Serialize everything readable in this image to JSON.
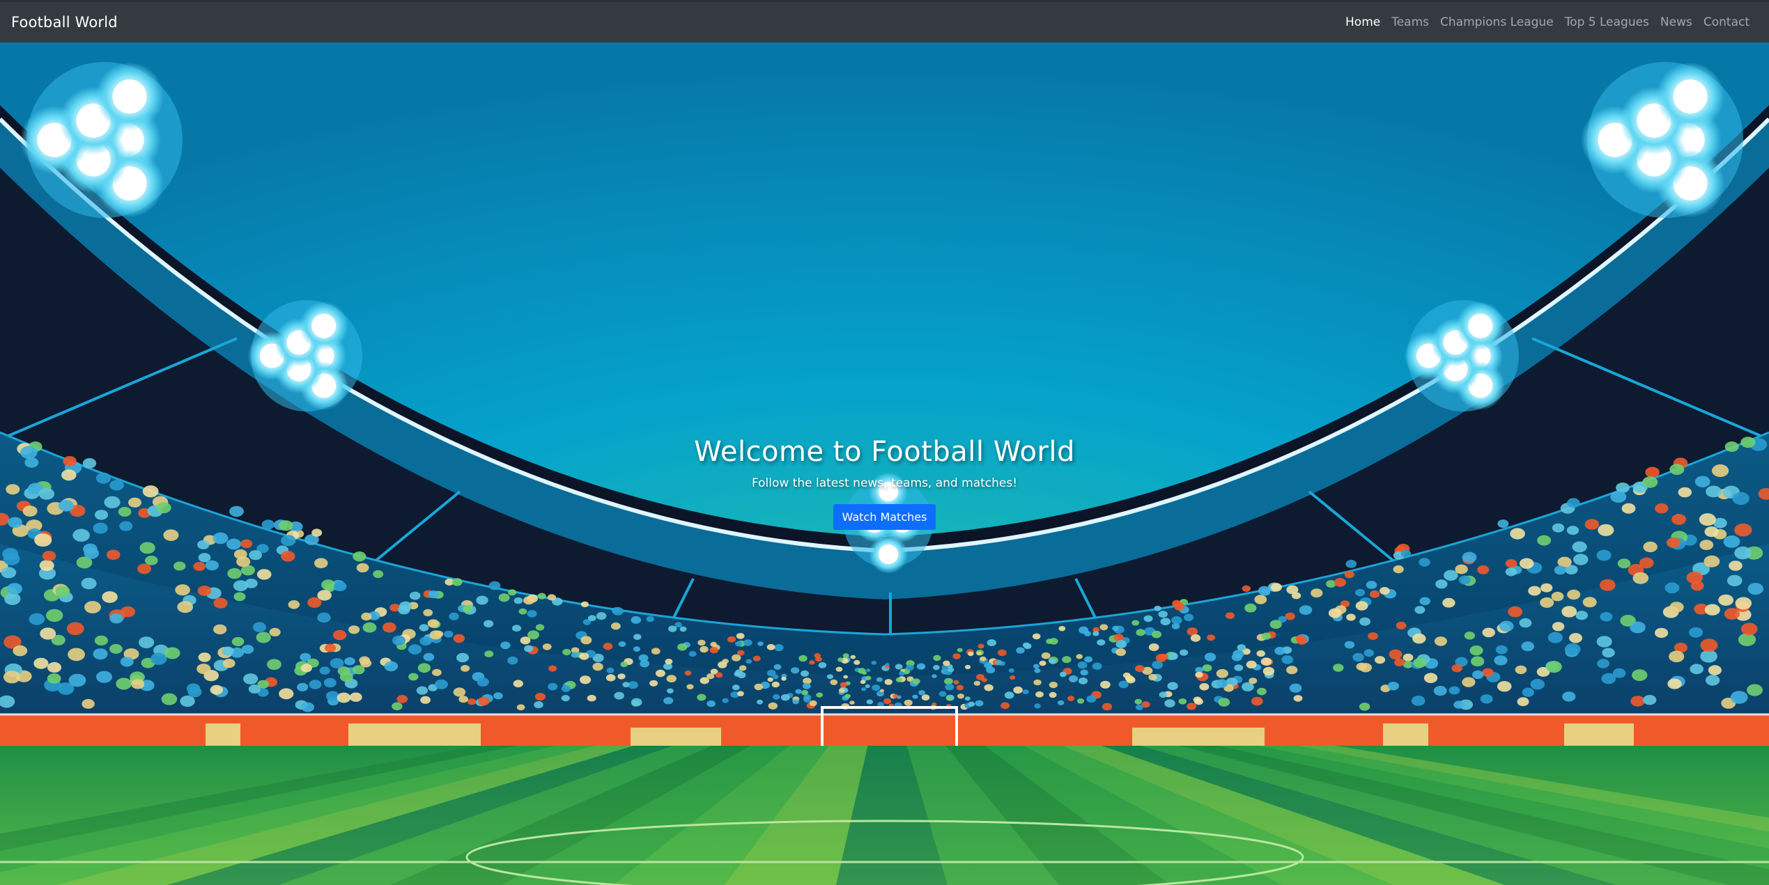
{
  "navbar": {
    "brand": "Football World",
    "links": [
      {
        "label": "Home",
        "active": true
      },
      {
        "label": "Teams",
        "active": false
      },
      {
        "label": "Champions League",
        "active": false
      },
      {
        "label": "Top 5 Leagues",
        "active": false
      },
      {
        "label": "News",
        "active": false
      },
      {
        "label": "Contact",
        "active": false
      }
    ]
  },
  "hero": {
    "title": "Welcome to Football World",
    "subtitle": "Follow the latest news, teams, and matches!",
    "button_label": "Watch Matches",
    "background_image": "stadium-illustration"
  },
  "colors": {
    "navbar_bg": "#343a40",
    "button_bg": "#0d6efd",
    "sky": "#0a9fc9",
    "pitch": "#3aa844",
    "ad_board": "#f05a2b"
  }
}
